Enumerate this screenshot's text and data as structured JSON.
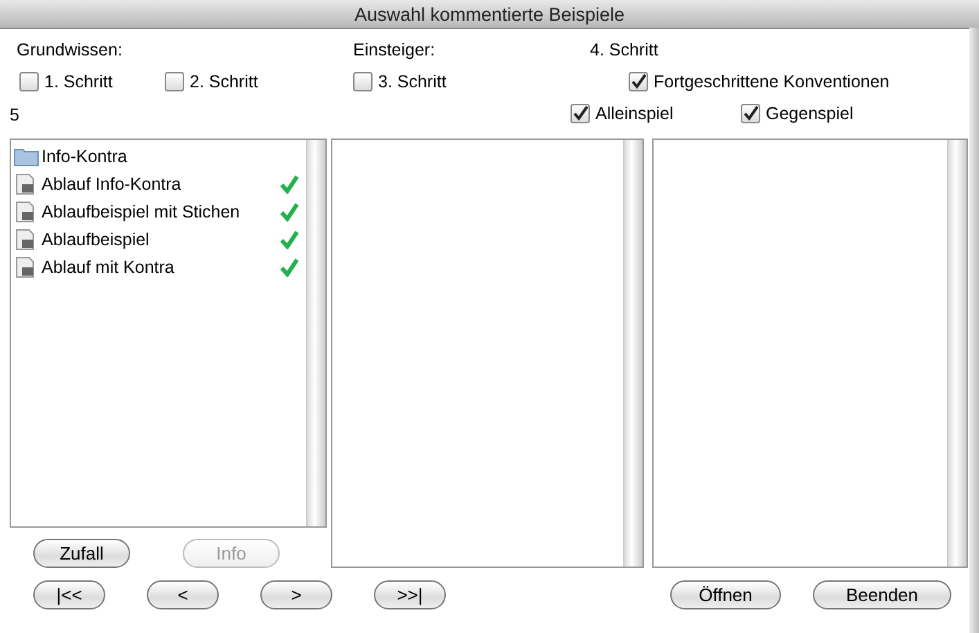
{
  "window": {
    "title": "Auswahl kommentierte Beispiele"
  },
  "groups": [
    {
      "label": "Grundwissen:"
    },
    {
      "label": "Einsteiger:"
    },
    {
      "label": "4. Schritt"
    }
  ],
  "steps": [
    {
      "label": "1. Schritt",
      "checked": false
    },
    {
      "label": "2. Schritt",
      "checked": false
    },
    {
      "label": "3. Schritt",
      "checked": false
    },
    {
      "label": "Fortgeschrittene Konventionen",
      "checked": true
    }
  ],
  "count": "5",
  "modes": [
    {
      "label": "Alleinspiel",
      "checked": true
    },
    {
      "label": "Gegenspiel",
      "checked": true
    }
  ],
  "list": [
    {
      "kind": "folder",
      "label": "Info-Kontra",
      "done": false
    },
    {
      "kind": "document",
      "label": "Ablauf Info-Kontra",
      "done": true
    },
    {
      "kind": "document",
      "label": "Ablaufbeispiel mit Stichen",
      "done": true
    },
    {
      "kind": "document",
      "label": "Ablaufbeispiel",
      "done": true
    },
    {
      "kind": "document",
      "label": "Ablauf mit Kontra",
      "done": true
    }
  ],
  "list_buttons": [
    {
      "label": "Zufall",
      "disabled": false
    },
    {
      "label": "Info",
      "disabled": true
    }
  ],
  "nav_buttons": [
    {
      "label": "|<<"
    },
    {
      "label": "<"
    },
    {
      "label": ">"
    },
    {
      "label": ">>|"
    }
  ],
  "action_buttons": [
    {
      "label": "Öffnen"
    },
    {
      "label": "Beenden"
    }
  ]
}
